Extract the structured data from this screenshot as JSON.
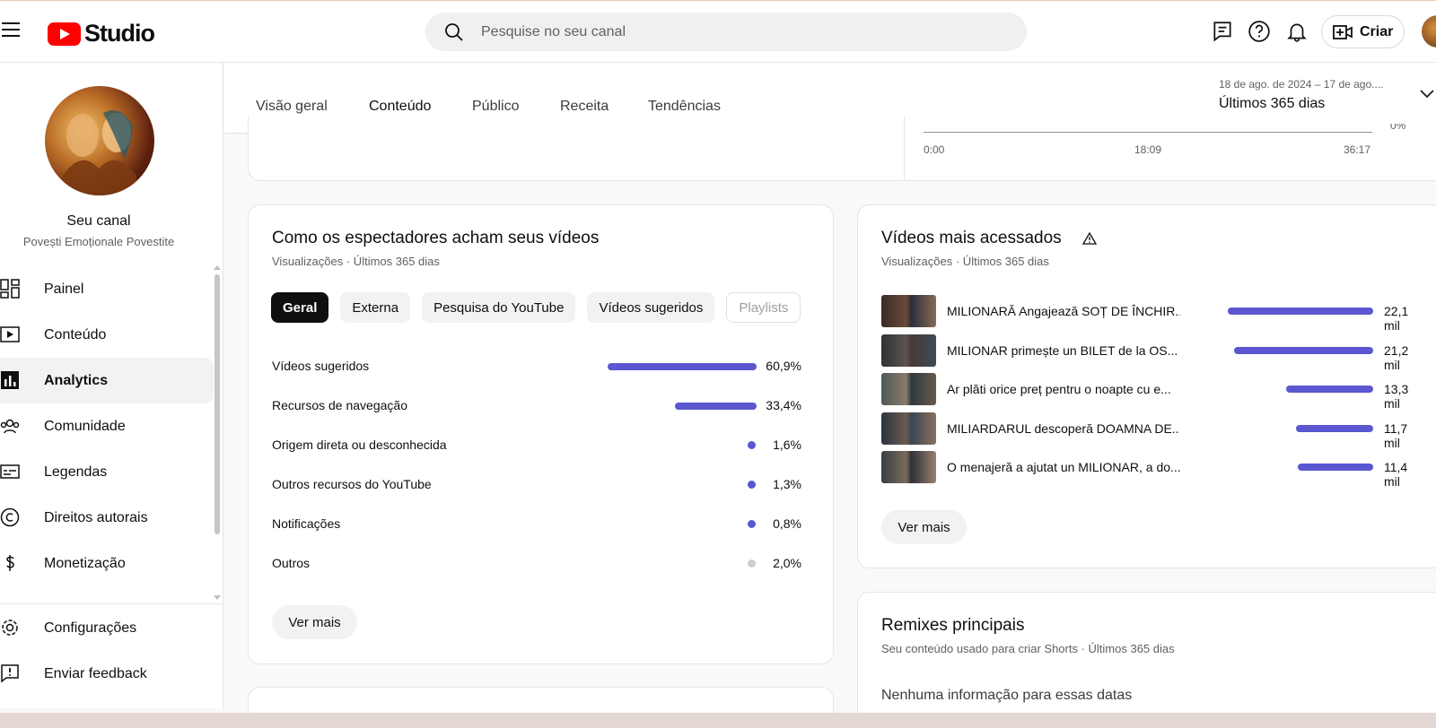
{
  "header": {
    "logo_text": "Studio",
    "search_placeholder": "Pesquise no seu canal",
    "create_label": "Criar"
  },
  "sidebar": {
    "channel_title": "Seu canal",
    "channel_name": "Povești Emoționale Povestite",
    "items": [
      {
        "label": "Painel",
        "icon": "dashboard-icon"
      },
      {
        "label": "Conteúdo",
        "icon": "content-icon"
      },
      {
        "label": "Analytics",
        "icon": "analytics-icon",
        "active": true
      },
      {
        "label": "Comunidade",
        "icon": "community-icon"
      },
      {
        "label": "Legendas",
        "icon": "subtitles-icon"
      },
      {
        "label": "Direitos autorais",
        "icon": "copyright-icon"
      },
      {
        "label": "Monetização",
        "icon": "monetization-icon"
      }
    ],
    "bottom_items": [
      {
        "label": "Configurações",
        "icon": "settings-icon"
      },
      {
        "label": "Enviar feedback",
        "icon": "feedback-icon"
      }
    ]
  },
  "tabs": {
    "items": [
      "Visão geral",
      "Conteúdo",
      "Público",
      "Receita",
      "Tendências"
    ],
    "active": "Conteúdo",
    "date_range": "18 de ago. de 2024 – 17 de ago....",
    "date_label": "Últimos 365 dias"
  },
  "top_card": {
    "axis_ticks": [
      "0:00",
      "18:09",
      "36:17"
    ],
    "right_label": "0%"
  },
  "traffic_card": {
    "title": "Como os espectadores acham seus vídeos",
    "subtitle": "Visualizações · Últimos 365 dias",
    "chips": [
      "Geral",
      "Externa",
      "Pesquisa do YouTube",
      "Vídeos sugeridos",
      "Playlists"
    ],
    "rows": [
      {
        "name": "Vídeos sugeridos",
        "pct": "60,9%",
        "value": 60.9
      },
      {
        "name": "Recursos de navegação",
        "pct": "33,4%",
        "value": 33.4
      },
      {
        "name": "Origem direta ou desconhecida",
        "pct": "1,6%",
        "value": 1.6
      },
      {
        "name": "Outros recursos do YouTube",
        "pct": "1,3%",
        "value": 1.3
      },
      {
        "name": "Notificações",
        "pct": "0,8%",
        "value": 0.8
      },
      {
        "name": "Outros",
        "pct": "2,0%",
        "value": 2.0
      }
    ],
    "more_label": "Ver mais",
    "colors": {
      "bar": "#5a57d1",
      "other": "#cfcfcf"
    }
  },
  "top_videos_card": {
    "title": "Vídeos mais acessados",
    "subtitle": "Visualizações · Últimos 365 dias",
    "rows": [
      {
        "title": "MILIONARĂ Angajează SOȚ DE ÎNCHIR...",
        "views": "22,1 mil",
        "value": 22.1
      },
      {
        "title": "MILIONAR primește un BILET de la OS...",
        "views": "21,2 mil",
        "value": 21.2
      },
      {
        "title": "Ar plăti orice preț pentru o noapte cu e...",
        "views": "13,3 mil",
        "value": 13.3
      },
      {
        "title": "MILIARDARUL descoperă DOAMNA DE...",
        "views": "11,7 mil",
        "value": 11.7
      },
      {
        "title": "O menajeră a ajutat un MILIONAR, a do...",
        "views": "11,4 mil",
        "value": 11.4
      }
    ],
    "more_label": "Ver mais"
  },
  "remix_card": {
    "title": "Remixes principais",
    "subtitle": "Seu conteúdo usado para criar Shorts · Últimos 365 dias",
    "empty_text": "Nenhuma informação para essas datas"
  }
}
